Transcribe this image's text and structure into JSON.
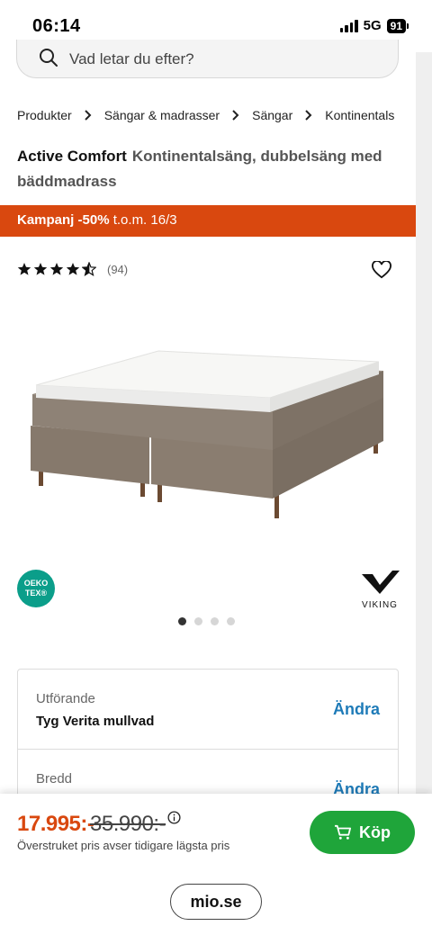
{
  "status_bar": {
    "time": "06:14",
    "network": "5G",
    "battery": "91"
  },
  "search": {
    "placeholder": "Vad letar du efter?"
  },
  "breadcrumb": [
    "Produkter",
    "Sängar & madrasser",
    "Sängar",
    "Kontinentals"
  ],
  "product": {
    "name": "Active Comfort",
    "subtitle": "Kontinentalsäng, dubbelsäng med bäddmadrass",
    "rating_count": "(94)",
    "rating": 4.5
  },
  "promo": {
    "label": "Kampanj -50%",
    "period": "t.o.m. 16/3",
    "color": "#d9480f"
  },
  "badges": {
    "oeko_line1": "OEKO",
    "oeko_line2": "TEX®",
    "brand": "VIKING"
  },
  "gallery": {
    "total_images": 4,
    "active_index": 0
  },
  "options": [
    {
      "label": "Utförande",
      "value": "Tyg Verita mullvad",
      "action": "Ändra"
    },
    {
      "label": "Bredd",
      "value": "",
      "action": "Ändra"
    }
  ],
  "purchase": {
    "price": "17.995:-",
    "old_price": "35.990:-",
    "note": "Överstruket pris avser tidigare lägsta pris",
    "buy_label": "Köp",
    "buy_color": "#1fa53a"
  },
  "browser": {
    "url": "mio.se"
  }
}
